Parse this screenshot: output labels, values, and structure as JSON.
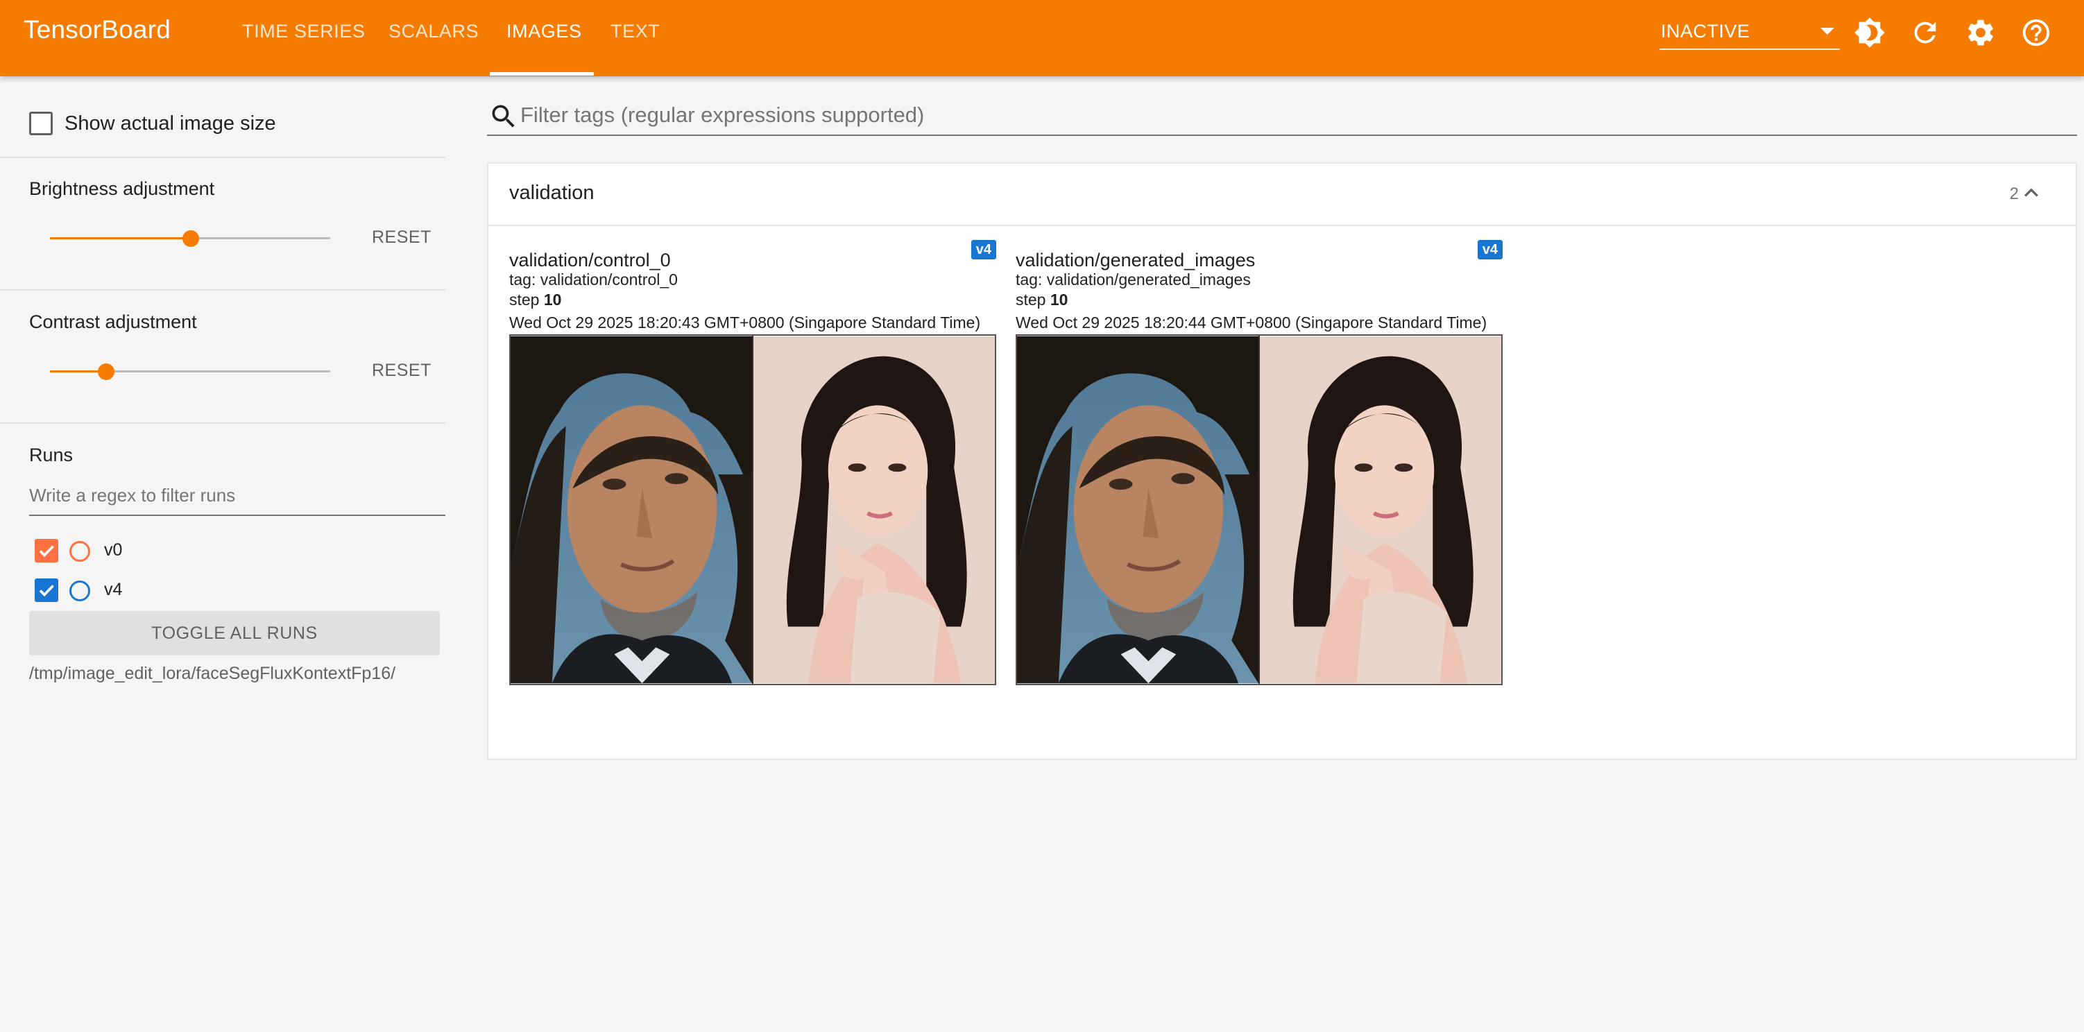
{
  "app": {
    "brand": "TensorBoard",
    "accent_color": "#f57c00"
  },
  "nav": {
    "tabs": [
      {
        "label": "TIME SERIES",
        "active": false
      },
      {
        "label": "SCALARS",
        "active": false
      },
      {
        "label": "IMAGES",
        "active": true
      },
      {
        "label": "TEXT",
        "active": false
      }
    ]
  },
  "header": {
    "status_select": "INACTIVE",
    "icons": [
      "brightness-icon",
      "reload-icon",
      "settings-icon",
      "help-icon"
    ]
  },
  "sidebar": {
    "show_actual_size": {
      "label": "Show actual image size",
      "checked": false
    },
    "brightness": {
      "title": "Brightness adjustment",
      "value": 0.5,
      "reset_label": "RESET"
    },
    "contrast": {
      "title": "Contrast adjustment",
      "value": 0.2,
      "reset_label": "RESET"
    },
    "runs": {
      "title": "Runs",
      "filter_placeholder": "Write a regex to filter runs",
      "items": [
        {
          "name": "v0",
          "checked": true,
          "color": "#ff7043"
        },
        {
          "name": "v4",
          "checked": true,
          "color": "#1976d2"
        }
      ],
      "toggle_all_label": "TOGGLE ALL RUNS",
      "logdir": "/tmp/image_edit_lora/faceSegFluxKontextFp16/"
    }
  },
  "main": {
    "filter_placeholder": "Filter tags (regular expressions supported)",
    "group": {
      "name": "validation",
      "count": "2",
      "images": [
        {
          "title": "validation/control_0",
          "tag": "tag: validation/control_0",
          "step_label": "step",
          "step_value": "10",
          "timestamp": "Wed Oct 29 2025 18:20:43 GMT+0800 (Singapore Standard Time)",
          "run": "v4"
        },
        {
          "title": "validation/generated_images",
          "tag": "tag: validation/generated_images",
          "step_label": "step",
          "step_value": "10",
          "timestamp": "Wed Oct 29 2025 18:20:44 GMT+0800 (Singapore Standard Time)",
          "run": "v4"
        }
      ]
    }
  }
}
